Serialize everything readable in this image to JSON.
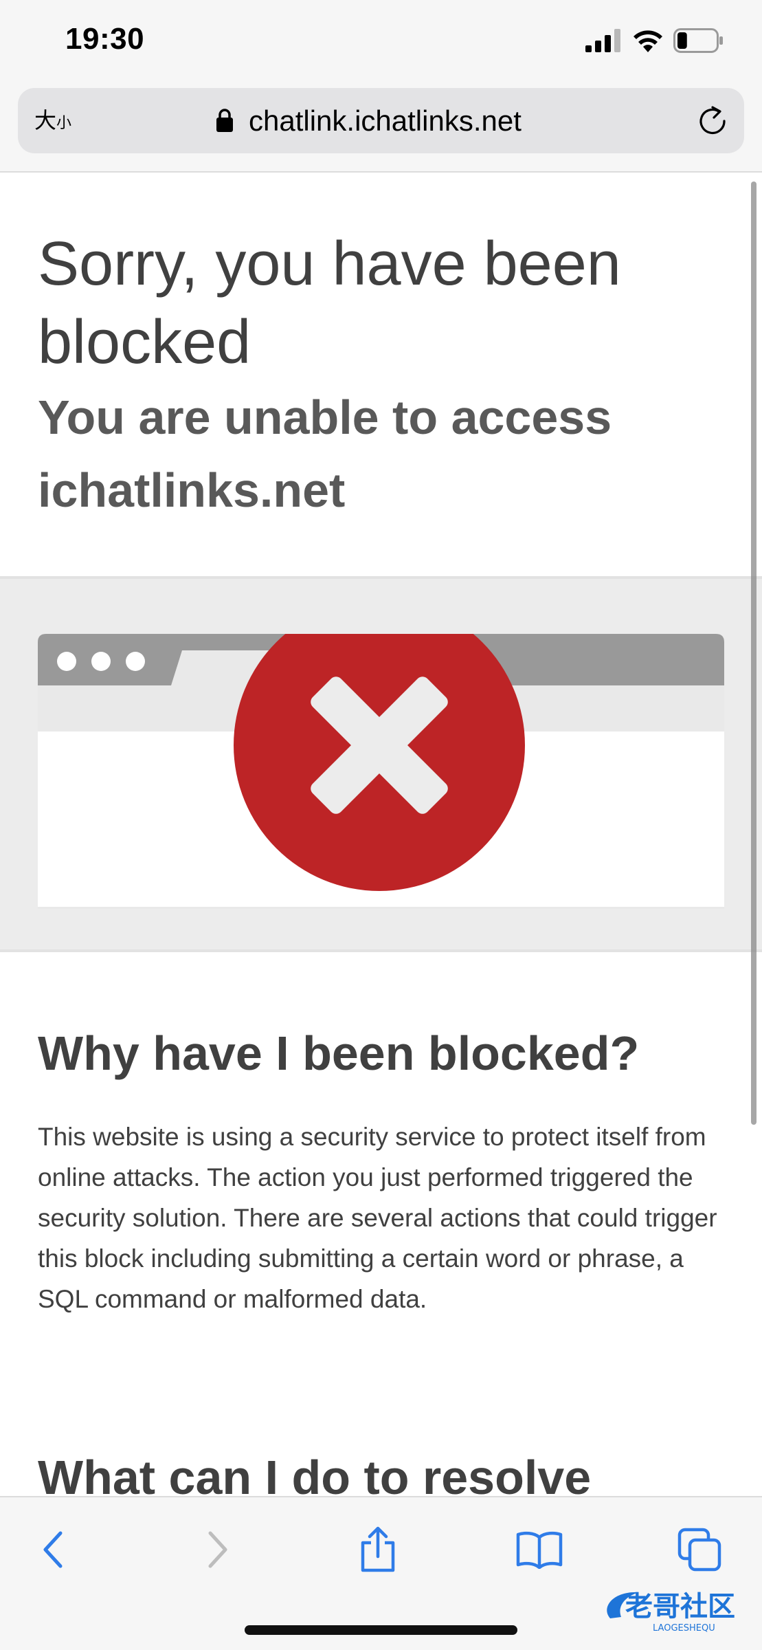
{
  "status_bar": {
    "time": "19:30",
    "signal_icon": "cellular-signal-icon",
    "wifi_icon": "wifi-icon",
    "battery_icon": "battery-icon",
    "battery_level": 0.25
  },
  "address_bar": {
    "text_size_label_large": "大",
    "text_size_label_small": "小",
    "lock_icon": "lock-icon",
    "url": "chatlink.ichatlinks.net",
    "reload_icon": "reload-icon"
  },
  "page": {
    "title": "Sorry, you have been blocked",
    "subtitle": "You are unable to access ichatlinks.net",
    "illustration_icon": "blocked-browser-icon",
    "why_heading": "Why have I been blocked?",
    "why_body": "This website is using a security service to protect itself from online attacks. The action you just performed triggered the security solution. There are several actions that could trigger this block including submitting a certain word or phrase, a SQL command or malformed data.",
    "resolve_heading": "What can I do to resolve"
  },
  "bottom_toolbar": {
    "back_icon": "chevron-left-icon",
    "forward_icon": "chevron-right-icon",
    "share_icon": "share-icon",
    "bookmarks_icon": "book-icon",
    "tabs_icon": "tabs-icon",
    "watermark_text": "老哥社区",
    "watermark_subtext": "LAOGESHEQU"
  },
  "colors": {
    "chrome_bg": "#f6f6f6",
    "address_field": "#e3e3e5",
    "text_dark": "#404040",
    "illustration_bg": "#ececec",
    "error_red": "#bd2426",
    "accent_blue": "#2f7ce8"
  }
}
